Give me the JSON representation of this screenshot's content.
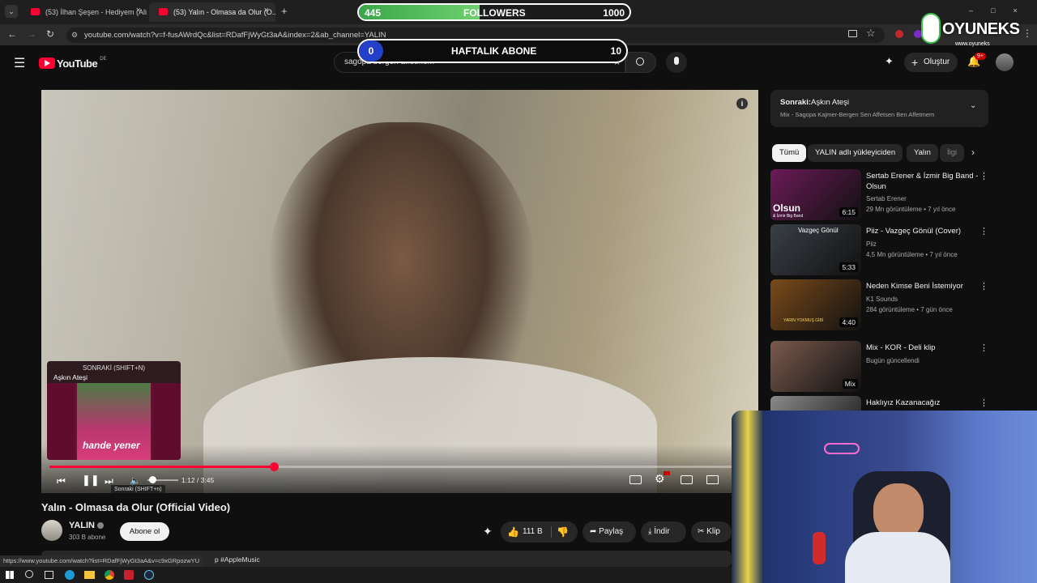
{
  "browser": {
    "tabs": [
      {
        "title": "(53) İlhan Şeşen - Hediyem (Ali..."
      },
      {
        "title": "(53) Yalın - Olmasa da Olur (O..."
      }
    ],
    "new_tab": "+",
    "url": "youtube.com/watch?v=f-fusAWrdQc&list=RDafFjWyGt3aA&index=2&ab_channel=YALIN",
    "status_url": "https://www.youtube.com/watch?list=RDafFjWyGt3aA&v=c9xGRpozwYU"
  },
  "youtube": {
    "logo": "YouTube",
    "region": "DE",
    "search_value": "sagopa bergen affetmem",
    "create_label": "Oluştur",
    "notif_count": "9+"
  },
  "overlay": {
    "followers": {
      "current": "445",
      "label": "FOLLOWERS",
      "goal": "1000",
      "progress": 0.445
    },
    "subs": {
      "current": "0",
      "label": "HAFTALIK ABONE",
      "goal": "10",
      "progress": 0.0
    },
    "brand": "OYUNEKS",
    "brand_url": "www.oyuneks"
  },
  "player": {
    "time": "1:12 / 3:45",
    "progress": 0.32,
    "next_tooltip": "Sonraki (SHIFT+n)",
    "next_card_header": "SONRAKİ (SHIFT+N)",
    "next_card_title": "Aşkın Ateşi",
    "next_card_art": "hande yener",
    "info_icon": "i"
  },
  "video": {
    "title": "Yalın - Olmasa da Olur (Official Video)",
    "channel": "YALIN",
    "subs": "303 B abone",
    "subscribe": "Abone ol",
    "likes": "111 B",
    "share": "Paylaş",
    "download": "İndir",
    "clip": "Klip",
    "hashtag_text": "p #AppleMusic"
  },
  "sidebar": {
    "next_label": "Sonraki:",
    "next_title": "Aşkın Ateşi",
    "mix_sub": "Mix - Sagopa Kajmer-Bergen Sen Affetsen Ben Affetmem",
    "chips": [
      "Tümü",
      "YALIN adlı yükleyiciden",
      "Yalın",
      "İlgi"
    ],
    "videos": [
      {
        "title": "Sertab Erener & İzmir Big Band - Olsun",
        "channel": "Sertab Erener",
        "meta": "29 Mn görüntüleme • 7 yıl önce",
        "duration": "6:15",
        "thumb_text": "Olsun",
        "thumb_sub": "& İzmir Big Band",
        "color": "#6b1a57"
      },
      {
        "title": "Piiz - Vazgeç Gönül (Cover)",
        "channel": "Piiz",
        "meta": "4,5 Mn görüntüleme • 7 yıl önce",
        "duration": "5:33",
        "thumb_text": "Vazgeç Gönül",
        "color": "#3a3f47"
      },
      {
        "title": "Neden Kimse Beni İstemiyor",
        "channel": "K1 Sounds",
        "meta": "284 görüntüleme • 7 gün önce",
        "duration": "4:40",
        "thumb_text": "YARIN YOKMUŞ GİBİ",
        "color": "#7a4a1a"
      },
      {
        "title": "Mix - KOR - Deli klip",
        "channel": "Bugün güncellendi",
        "meta": "",
        "duration": "Mix",
        "color": "#7a5a4e"
      },
      {
        "title": "Haklıyız Kazanacağız",
        "channel": "",
        "meta": "",
        "duration": "",
        "color": "#8a8a8a"
      }
    ]
  }
}
